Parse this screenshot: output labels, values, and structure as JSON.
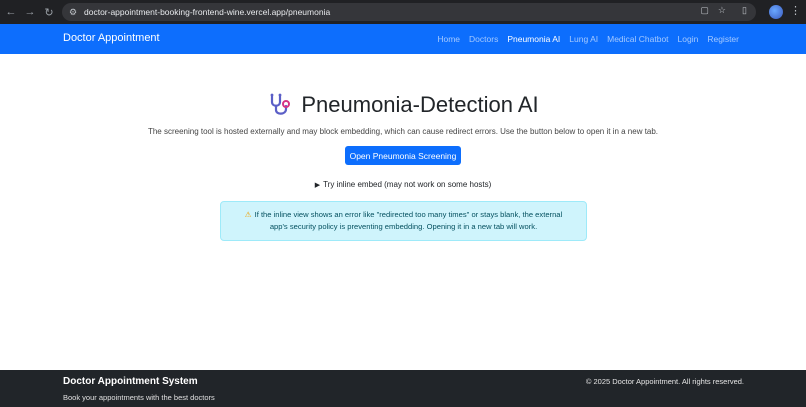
{
  "browser": {
    "url": "doctor-appointment-booking-frontend-wine.vercel.app/pneumonia",
    "icons": [
      "back-icon",
      "forward-icon",
      "reload-icon",
      "site-info-icon",
      "cast-icon",
      "bookmark-star-icon",
      "extensions-icon",
      "profile-avatar",
      "menu-icon"
    ]
  },
  "navbar": {
    "brand": "Doctor Appointment",
    "links": [
      {
        "label": "Home"
      },
      {
        "label": "Doctors"
      },
      {
        "label": "Pneumonia AI",
        "active": true
      },
      {
        "label": "Lung AI"
      },
      {
        "label": "Medical Chatbot"
      },
      {
        "label": "Login"
      },
      {
        "label": "Register"
      }
    ]
  },
  "main": {
    "title": "Pneumonia-Detection AI",
    "title_icon": "stethoscope-icon",
    "subtitle": "The screening tool is hosted externally and may block embedding, which can cause redirect errors. Use the button below to open it in a new tab.",
    "open_button": "Open Pneumonia Screening",
    "details_summary": "Try inline embed (may not work on some hosts)",
    "alert_line1": "If the inline view shows an error like \"redirected too many times\" or stays blank, the external",
    "alert_line2": "app's security policy is preventing embedding. Opening it in a new tab will work."
  },
  "footer": {
    "title": "Doctor Appointment System",
    "subtitle": "Book your appointments with the best doctors",
    "copyright": "© 2025 Doctor Appointment. All rights reserved."
  },
  "colors": {
    "primary": "#0d6efd",
    "chrome_bg": "#202124",
    "footer_bg": "#212529",
    "alert_bg": "#cff4fc",
    "alert_text": "#055160"
  }
}
